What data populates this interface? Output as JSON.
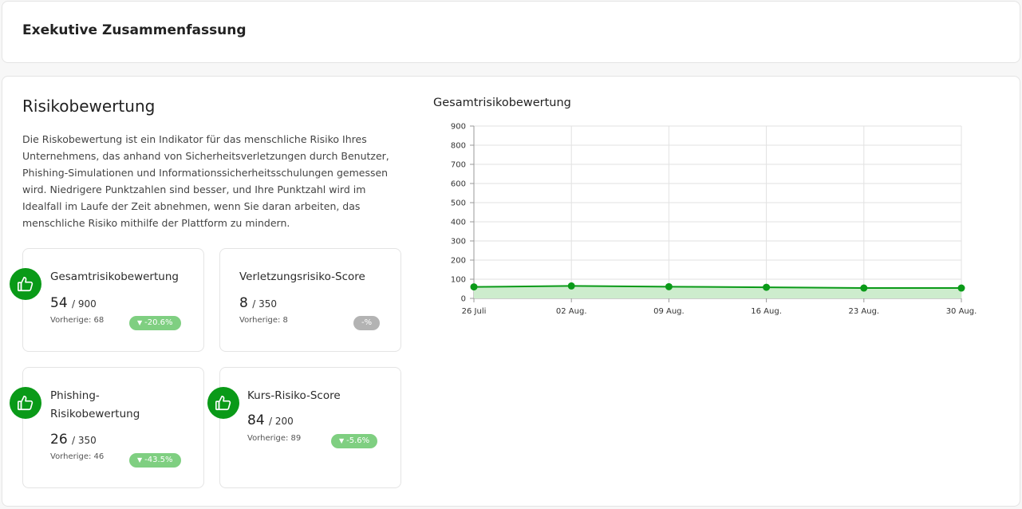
{
  "header": {
    "title": "Exekutive Zusammenfassung"
  },
  "risk": {
    "title": "Risikobewertung",
    "description": "Die Riskobewertung ist ein Indikator für das menschliche Risiko Ihres Unternehmens, das anhand von Sicherheitsverletzungen durch Benutzer, Phishing-Simulationen und Informationssicherheitsschulungen gemessen wird. Niedrigere Punktzahlen sind besser, und Ihre Punktzahl wird im Idealfall im Laufe der Zeit abnehmen, wenn Sie daran arbeiten, das menschliche Risiko mithilfe der Plattform zu mindern."
  },
  "cards": [
    {
      "title": "Gesamtrisikobewertung",
      "value": "54",
      "max": "/ 900",
      "previous": "Vorherige: 68",
      "change": "-20.6%",
      "icon": "thumbs-up-icon"
    },
    {
      "title": "Verletzungsrisiko-Score",
      "value": "8",
      "max": "/ 350",
      "previous": "Vorherige: 8",
      "change": "-%"
    },
    {
      "title": "Phishing-Risikobewertung",
      "value": "26",
      "max": "/ 350",
      "previous": "Vorherige: 46",
      "change": "-43.5%",
      "icon": "thumbs-up-icon"
    },
    {
      "title": "Kurs-Risiko-Score",
      "value": "84",
      "max": "/ 200",
      "previous": "Vorherige: 89",
      "change": "-5.6%",
      "icon": "thumbs-up-icon"
    }
  ],
  "colors": {
    "accent": "#0a9a18",
    "badge_positive": "#7fcf81",
    "badge_neutral": "#b3b3b3",
    "area_fill": "#cdeccd"
  },
  "chart_data": {
    "type": "area",
    "title": "Gesamtrisikobewertung",
    "categories": [
      "26 Juli",
      "02 Aug.",
      "09 Aug.",
      "16 Aug.",
      "23 Aug.",
      "30 Aug."
    ],
    "series": [
      {
        "values": [
          60,
          65,
          61,
          58,
          54,
          54
        ]
      }
    ],
    "ylim": [
      0,
      900
    ],
    "yticks": [
      0,
      100,
      200,
      300,
      400,
      500,
      600,
      700,
      800,
      900
    ],
    "grid": true,
    "legend": "none"
  }
}
